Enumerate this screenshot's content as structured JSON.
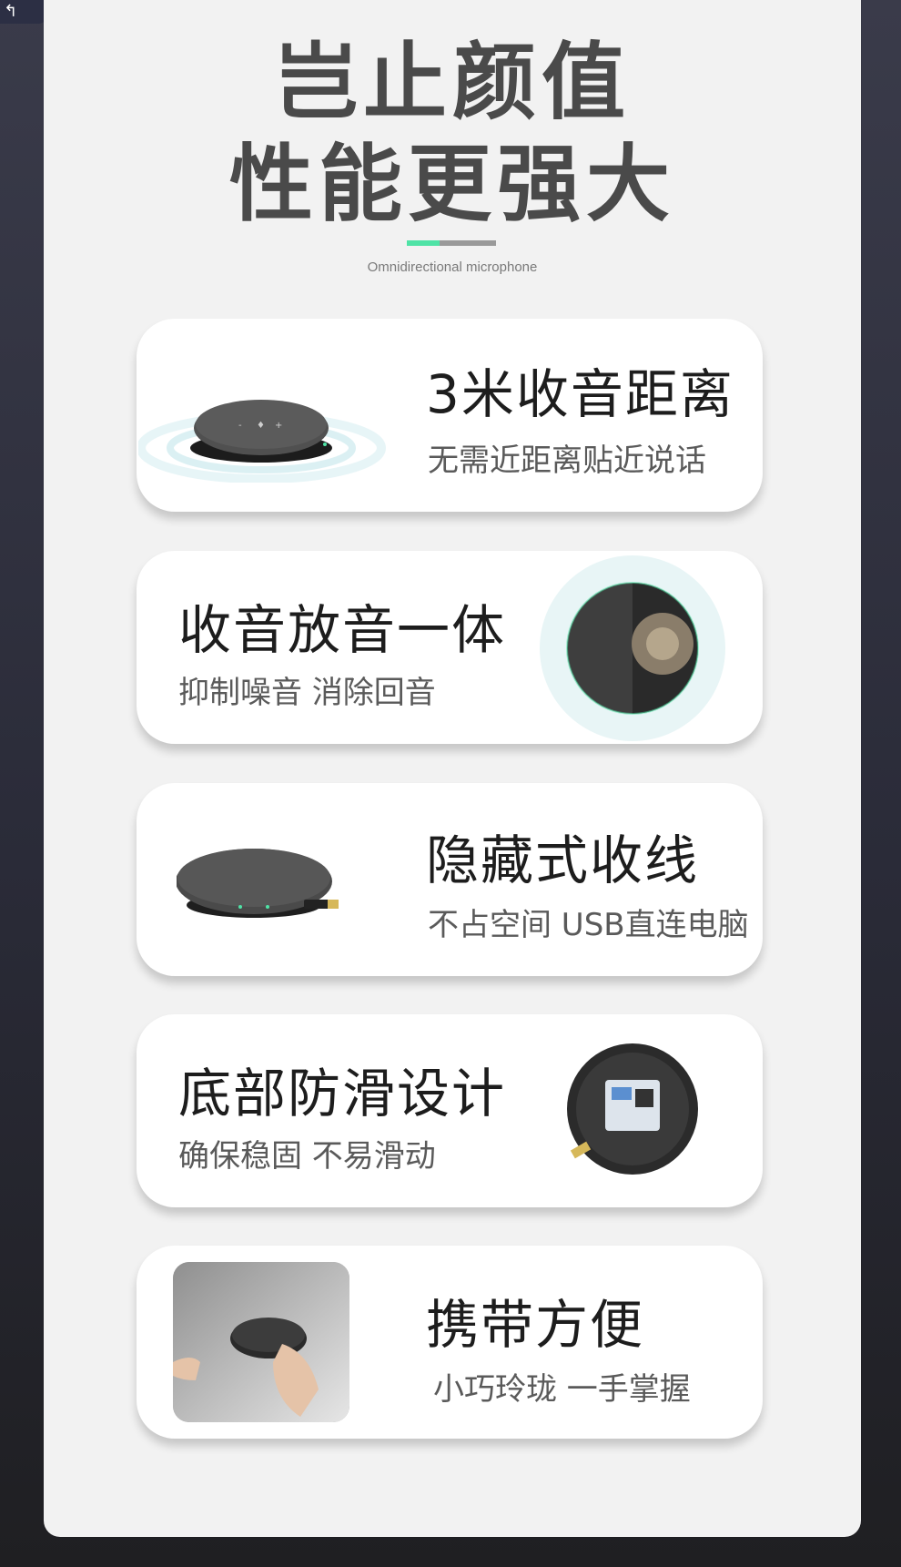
{
  "corner": {
    "icon": "arrow-left-icon",
    "glyph": "↰"
  },
  "header": {
    "line1": "岂止颜值",
    "line2": "性能更强大",
    "subtitle": "Omnidirectional microphone",
    "accent_color": "#4fe3a6"
  },
  "features": [
    {
      "title": "3米收音距离",
      "description": "无需近距离贴近说话",
      "image": "speaker-side-sound-waves"
    },
    {
      "title": "收音放音一体",
      "description": "抑制噪音 消除回音",
      "image": "speaker-top-cutaway"
    },
    {
      "title": "隐藏式收线",
      "description": "不占空间 USB直连电脑",
      "image": "speaker-side-usb-cable"
    },
    {
      "title": "底部防滑设计",
      "description": "确保稳固 不易滑动",
      "image": "speaker-bottom-label"
    },
    {
      "title": "携带方便",
      "description": "小巧玲珑 一手掌握",
      "image": "speaker-in-hand-bag"
    }
  ]
}
